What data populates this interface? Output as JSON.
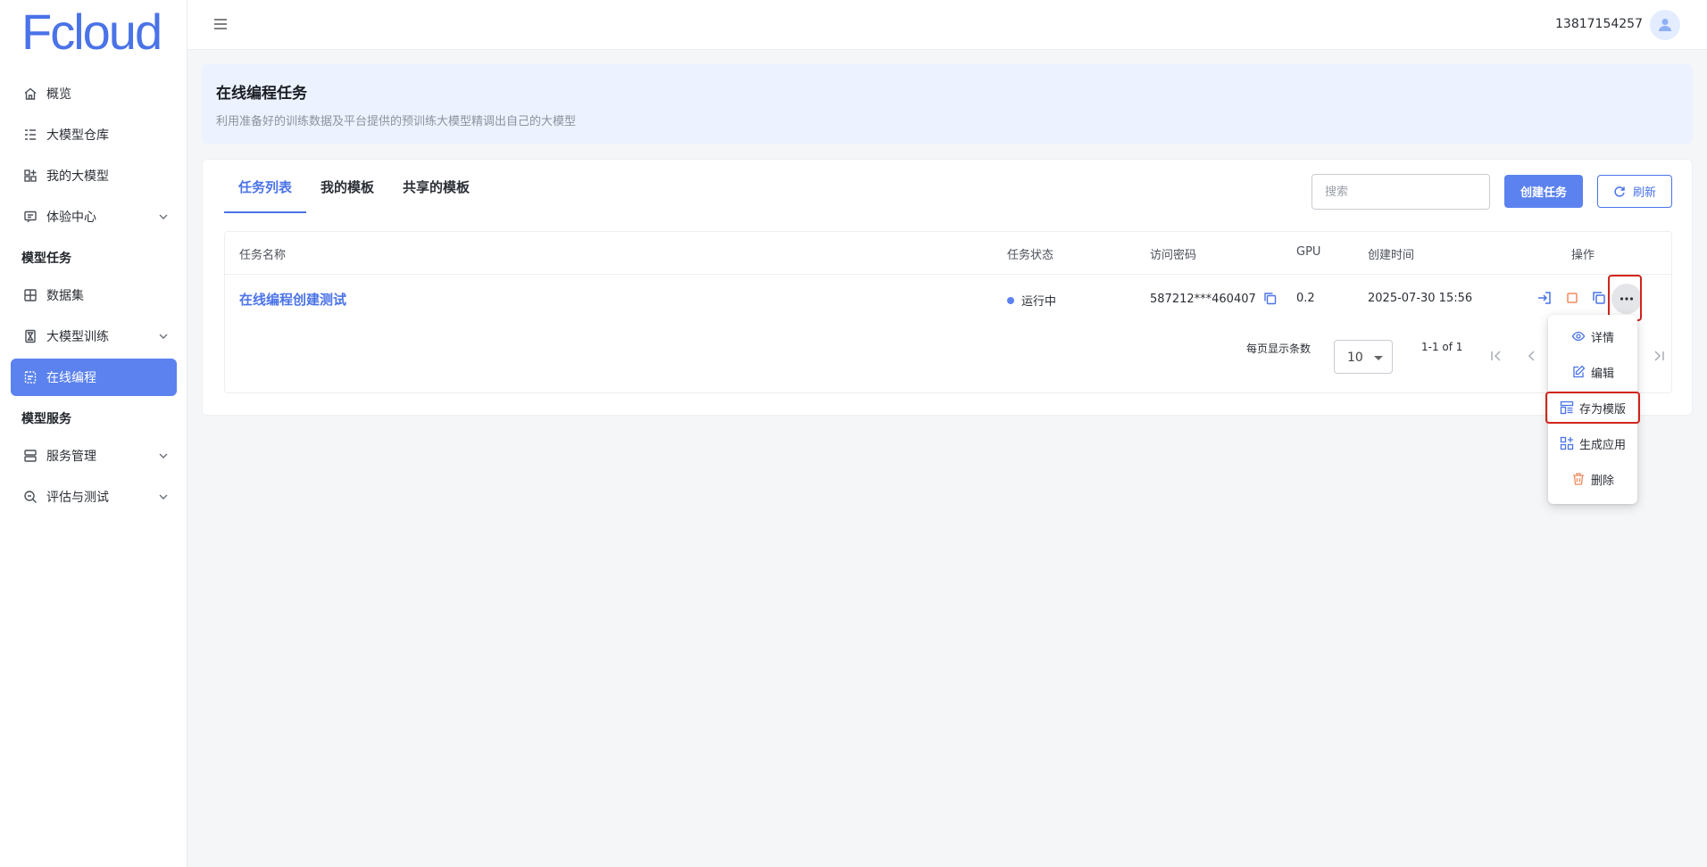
{
  "app": {
    "logo": "Fcloud",
    "user_phone": "13817154257"
  },
  "sidebar": {
    "items": [
      {
        "label": "概览"
      },
      {
        "label": "大模型仓库"
      },
      {
        "label": "我的大模型"
      },
      {
        "label": "体验中心"
      }
    ],
    "section_tasks": "模型任务",
    "task_items": [
      {
        "label": "数据集"
      },
      {
        "label": "大模型训练"
      },
      {
        "label": "在线编程"
      }
    ],
    "section_services": "模型服务",
    "service_items": [
      {
        "label": "服务管理"
      },
      {
        "label": "评估与测试"
      }
    ]
  },
  "hero": {
    "title": "在线编程任务",
    "subtitle": "利用准备好的训练数据及平台提供的预训练大模型精调出自己的大模型"
  },
  "tabs": [
    {
      "label": "任务列表"
    },
    {
      "label": "我的模板"
    },
    {
      "label": "共享的模板"
    }
  ],
  "toolbar": {
    "search_placeholder": "搜索",
    "create_label": "创建任务",
    "refresh_label": "刷新"
  },
  "table": {
    "columns": [
      "任务名称",
      "任务状态",
      "访问密码",
      "GPU",
      "创建时间",
      "操作"
    ],
    "rows": [
      {
        "name": "在线编程创建测试",
        "status": "运行中",
        "password": "587212***460407",
        "gpu": "0.2",
        "created": "2025-07-30 15:56"
      }
    ]
  },
  "pagination": {
    "page_size_label": "每页显示条数",
    "page_size": "10",
    "range": "1-1 of 1"
  },
  "dropdown": {
    "items": [
      {
        "label": "详情"
      },
      {
        "label": "编辑"
      },
      {
        "label": "存为模版"
      },
      {
        "label": "生成应用"
      },
      {
        "label": "删除"
      }
    ]
  },
  "colors": {
    "accent": "#4a73e8",
    "active_nav": "#5b82ee",
    "highlight": "#d0251c",
    "stop_icon": "#f08a5d",
    "delete_icon": "#f08a5d"
  }
}
